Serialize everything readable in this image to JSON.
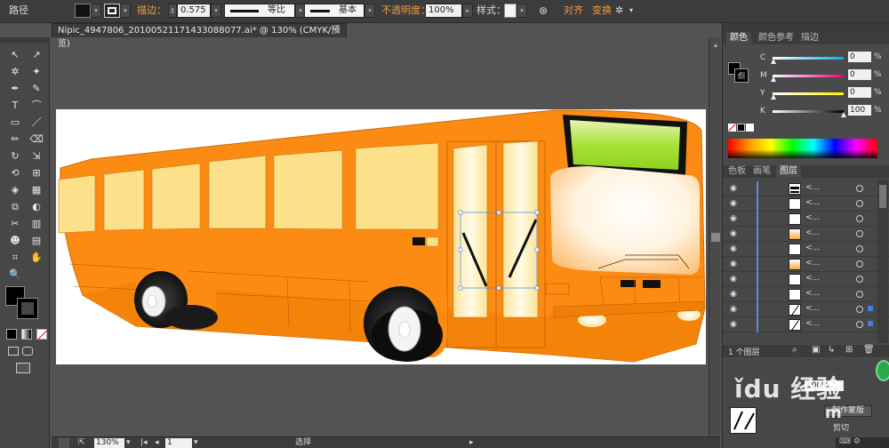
{
  "control_bar": {
    "object_type": "路径",
    "stroke_label": "描边：",
    "stroke_width": "0.575",
    "profile": "等比",
    "brush": "基本",
    "opacity_label": "不透明度：",
    "opacity_value": "100%",
    "style_label": "样式：",
    "align_label": "对齐",
    "transform_label": "变换"
  },
  "document": {
    "tab_title": "Nipic_4947806_20100521171433088077.ai* @ 130% (CMYK/预览)",
    "close_glyph": "×"
  },
  "tools": [
    "↖",
    "↗",
    "✲",
    "✦",
    "✒",
    "✎",
    "T",
    "⌒",
    "▭",
    "／",
    "✏",
    "⌫",
    "↻",
    "⇲",
    "⟲",
    "⊞",
    "◈",
    "▦",
    "⧉",
    "◐",
    "✂",
    "▥",
    "☻",
    "▤",
    "⌗",
    "✋",
    "🔍"
  ],
  "panels": {
    "color_tabs": [
      "颜色",
      "颜色参考",
      "描边"
    ],
    "channels": [
      {
        "label": "C",
        "value": "0",
        "pct": "%"
      },
      {
        "label": "M",
        "value": "0",
        "pct": "%"
      },
      {
        "label": "Y",
        "value": "0",
        "pct": "%"
      },
      {
        "label": "K",
        "value": "100",
        "pct": "%"
      }
    ],
    "layers_tabs": [
      "色板",
      "画笔",
      "图层"
    ],
    "layer_name": "<...",
    "layer_count": 10,
    "layers_footer": "1 个图层",
    "bottom_opacity": "100%",
    "make_mask": "制作蒙版",
    "clip": "剪切"
  },
  "status": {
    "zoom": "130%",
    "page": "1",
    "tool": "选择"
  },
  "watermark": {
    "text": "ǐdu 经验",
    "sub": "m"
  },
  "colors": {
    "bus_orange": "#fb8b12",
    "bus_dark_orange": "#e57a0a",
    "window": "#fde08a",
    "sign_green": "#a8e03a",
    "ui_dark": "#3c3c3c",
    "accent": "#f39c3a"
  }
}
